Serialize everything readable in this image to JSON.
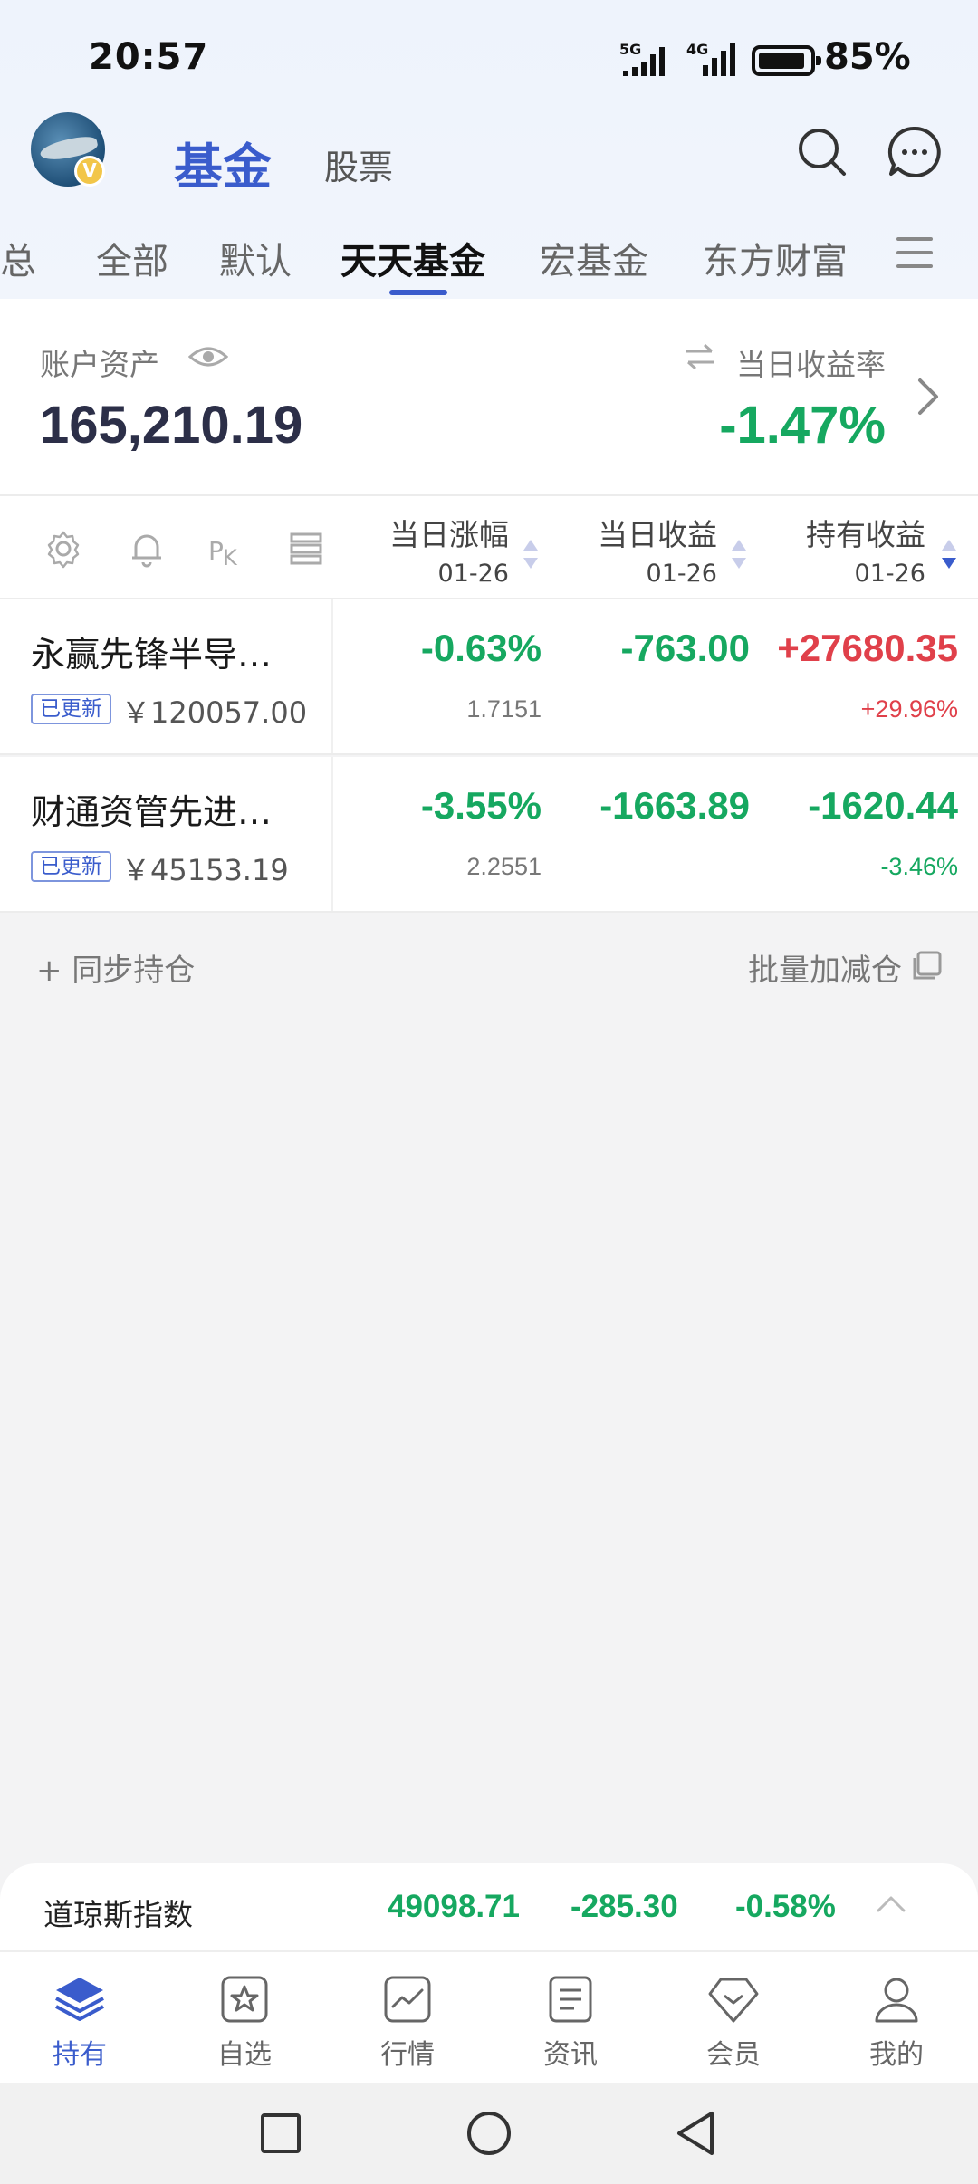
{
  "status_bar": {
    "time": "20:57",
    "network1": "5G",
    "network2": "4G",
    "battery": "85%"
  },
  "header": {
    "active_title": "基金",
    "other_title": "股票",
    "avatar_badge": "V"
  },
  "tabs": [
    {
      "label": "汇总"
    },
    {
      "label": "全部"
    },
    {
      "label": "默认"
    },
    {
      "label": "天天基金"
    },
    {
      "label": "宏基金"
    },
    {
      "label": "东方财富"
    }
  ],
  "summary": {
    "asset_label": "账户资产",
    "asset_value": "165,210.19",
    "rate_label": "当日收益率",
    "rate_value": "-1.47%"
  },
  "columns": [
    {
      "title": "当日涨幅",
      "date": "01-26"
    },
    {
      "title": "当日收益",
      "date": "01-26"
    },
    {
      "title": "持有收益",
      "date": "01-26"
    }
  ],
  "funds": [
    {
      "name": "永赢先锋半导…",
      "badge": "已更新",
      "holding": "￥120057.00",
      "change_pct": "-0.63%",
      "nav": "1.7151",
      "day_profit": "-763.00",
      "hold_profit": "+27680.35",
      "hold_profit_pct": "+29.96%"
    },
    {
      "name": "财通资管先进…",
      "badge": "已更新",
      "holding": "￥45153.19",
      "change_pct": "-3.55%",
      "nav": "2.2551",
      "day_profit": "-1663.89",
      "hold_profit": "-1620.44",
      "hold_profit_pct": "-3.46%"
    }
  ],
  "actions": {
    "sync": "+ 同步持仓",
    "batch": "批量加减仓"
  },
  "ticker": {
    "name": "道琼斯指数",
    "value": "49098.71",
    "change": "-285.30",
    "change_pct": "-0.58%"
  },
  "bottom_nav": [
    {
      "label": "持有",
      "icon": "layers-icon"
    },
    {
      "label": "自选",
      "icon": "star-icon"
    },
    {
      "label": "行情",
      "icon": "chart-icon"
    },
    {
      "label": "资讯",
      "icon": "news-icon"
    },
    {
      "label": "会员",
      "icon": "vip-icon"
    },
    {
      "label": "我的",
      "icon": "user-icon"
    }
  ],
  "colors": {
    "accent": "#3a5ccc",
    "down": "#16a860",
    "up": "#e0404a"
  }
}
